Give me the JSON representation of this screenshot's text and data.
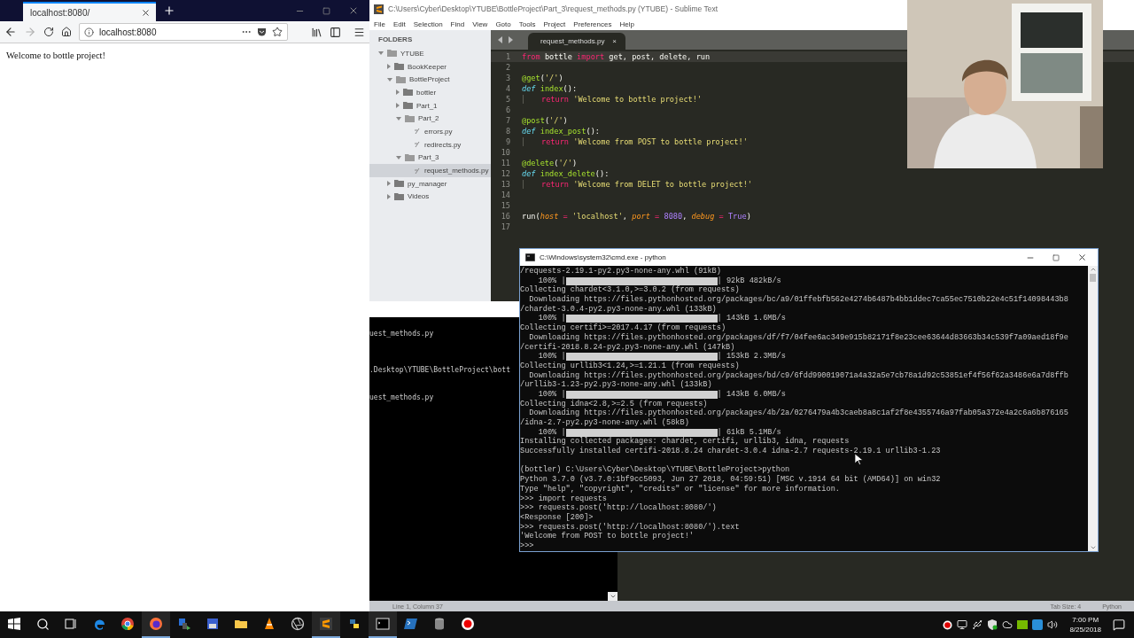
{
  "browser": {
    "tab": {
      "label": "localhost:8080/",
      "selected": true
    },
    "url": "localhost:8080",
    "can_go_forward": false,
    "content": "Welcome to bottle project!"
  },
  "editor": {
    "title": "C:\\Users\\Cyber\\Desktop\\YTUBE\\BottleProject\\Part_3\\request_methods.py (YTUBE) - Sublime Text",
    "menu": [
      "File",
      "Edit",
      "Selection",
      "Find",
      "View",
      "Goto",
      "Tools",
      "Project",
      "Preferences",
      "Help"
    ],
    "sidebar": {
      "heading": "FOLDERS",
      "items": [
        {
          "label": "YTUBE",
          "kind": "folder",
          "expanded": true,
          "selected": false,
          "children": [
            {
              "label": "BookKeeper",
              "kind": "folder",
              "expanded": false,
              "selected": false
            },
            {
              "label": "BottleProject",
              "kind": "folder",
              "expanded": true,
              "selected": false,
              "children": [
                {
                  "label": "bottler",
                  "kind": "folder",
                  "expanded": false,
                  "selected": false
                },
                {
                  "label": "Part_1",
                  "kind": "folder",
                  "expanded": false,
                  "selected": false
                },
                {
                  "label": "Part_2",
                  "kind": "folder",
                  "expanded": true,
                  "selected": false,
                  "children": [
                    {
                      "label": "errors.py",
                      "kind": "file",
                      "selected": false
                    },
                    {
                      "label": "redirects.py",
                      "kind": "file",
                      "selected": false
                    }
                  ]
                },
                {
                  "label": "Part_3",
                  "kind": "folder",
                  "expanded": true,
                  "selected": false,
                  "children": [
                    {
                      "label": "request_methods.py",
                      "kind": "file",
                      "selected": true
                    }
                  ]
                }
              ]
            },
            {
              "label": "py_manager",
              "kind": "folder",
              "expanded": false,
              "selected": false
            },
            {
              "label": "Videos",
              "kind": "folder",
              "expanded": false,
              "selected": false
            }
          ]
        }
      ]
    },
    "tab": {
      "label": "request_methods.py",
      "close": "×",
      "selected": true
    },
    "lines": [
      {
        "number": "1",
        "indented": false,
        "tokens": [
          {
            "kind": "keyword",
            "text": "from"
          },
          {
            "kind": "plain",
            "text": " bottle "
          },
          {
            "kind": "keyword",
            "text": "import"
          },
          {
            "kind": "plain",
            "text": " get, post, delete, run"
          }
        ]
      },
      {
        "number": "2"
      },
      {
        "number": "3",
        "indented": false,
        "tokens": [
          {
            "kind": "decorator",
            "text": "@get"
          },
          {
            "kind": "plain",
            "text": "("
          },
          {
            "kind": "string",
            "text": "'/'"
          },
          {
            "kind": "plain",
            "text": ")"
          }
        ]
      },
      {
        "number": "4",
        "indented": false,
        "tokens": [
          {
            "kind": "storage",
            "text": "def"
          },
          {
            "kind": "function",
            "text": " index"
          },
          {
            "kind": "plain",
            "text": "():"
          }
        ]
      },
      {
        "number": "5",
        "indented": true,
        "tokens": [
          {
            "kind": "keyword",
            "text": "return"
          },
          {
            "kind": "string",
            "text": " 'Welcome to bottle project!'"
          }
        ]
      },
      {
        "number": "6"
      },
      {
        "number": "7",
        "indented": false,
        "tokens": [
          {
            "kind": "decorator",
            "text": "@post"
          },
          {
            "kind": "plain",
            "text": "("
          },
          {
            "kind": "string",
            "text": "'/'"
          },
          {
            "kind": "plain",
            "text": ")"
          }
        ]
      },
      {
        "number": "8",
        "indented": false,
        "tokens": [
          {
            "kind": "storage",
            "text": "def"
          },
          {
            "kind": "function",
            "text": " index_post"
          },
          {
            "kind": "plain",
            "text": "():"
          }
        ]
      },
      {
        "number": "9",
        "indented": true,
        "tokens": [
          {
            "kind": "keyword",
            "text": "return"
          },
          {
            "kind": "string",
            "text": " 'Welcome from POST to bottle project!'"
          }
        ]
      },
      {
        "number": "10"
      },
      {
        "number": "11",
        "indented": false,
        "tokens": [
          {
            "kind": "decorator",
            "text": "@delete"
          },
          {
            "kind": "plain",
            "text": "("
          },
          {
            "kind": "string",
            "text": "'/'"
          },
          {
            "kind": "plain",
            "text": ")"
          }
        ]
      },
      {
        "number": "12",
        "indented": false,
        "tokens": [
          {
            "kind": "storage",
            "text": "def"
          },
          {
            "kind": "function",
            "text": " index_delete"
          },
          {
            "kind": "plain",
            "text": "():"
          }
        ]
      },
      {
        "number": "13",
        "indented": true,
        "tokens": [
          {
            "kind": "keyword",
            "text": "return"
          },
          {
            "kind": "string",
            "text": " 'Welcome from DELET to bottle project!'"
          }
        ]
      },
      {
        "number": "14"
      },
      {
        "number": "15"
      },
      {
        "number": "16",
        "indented": false,
        "tokens": [
          {
            "kind": "plain",
            "text": "run("
          },
          {
            "kind": "param",
            "text": "host"
          },
          {
            "kind": "keyword",
            "text": " = "
          },
          {
            "kind": "string",
            "text": "'localhost'"
          },
          {
            "kind": "plain",
            "text": ", "
          },
          {
            "kind": "param",
            "text": "port"
          },
          {
            "kind": "keyword",
            "text": " = "
          },
          {
            "kind": "number",
            "text": "8080"
          },
          {
            "kind": "plain",
            "text": ", "
          },
          {
            "kind": "param",
            "text": "debug"
          },
          {
            "kind": "keyword",
            "text": " = "
          },
          {
            "kind": "number",
            "text": "True"
          },
          {
            "kind": "plain",
            "text": ")"
          }
        ]
      },
      {
        "number": "17"
      }
    ],
    "status": {
      "position": "Line 1, Column 37",
      "tab_size": "Tab Size: 4",
      "syntax": "Python"
    }
  },
  "back_window": {
    "lines": [
      "uest_methods.py",
      ".Desktop\\YTUBE\\BottleProject\\bott",
      "uest_methods.py"
    ]
  },
  "terminal": {
    "title": "C:\\Windows\\system32\\cmd.exe - python",
    "lines": [
      {
        "kind": "text",
        "text": "/requests-2.19.1-py2.py3-none-any.whl (91kB)"
      },
      {
        "kind": "progress",
        "percent": "    100% |",
        "reading": "| 92kB 482kB/s"
      },
      {
        "kind": "text",
        "text": "Collecting chardet<3.1.0,>=3.0.2 (from requests)"
      },
      {
        "kind": "text",
        "text": "  Downloading https://files.pythonhosted.org/packages/bc/a9/01ffebfb562e4274b6487b4bb1ddec7ca55ec7510b22e4c51f14098443b8"
      },
      {
        "kind": "text",
        "text": "/chardet-3.0.4-py2.py3-none-any.whl (133kB)"
      },
      {
        "kind": "progress",
        "percent": "    100% |",
        "reading": "| 143kB 1.6MB/s"
      },
      {
        "kind": "text",
        "text": "Collecting certifi>=2017.4.17 (from requests)"
      },
      {
        "kind": "text",
        "text": "  Downloading https://files.pythonhosted.org/packages/df/f7/04fee6ac349e915b82171f8e23cee63644d83663b34c539f7a09aed18f9e"
      },
      {
        "kind": "text",
        "text": "/certifi-2018.8.24-py2.py3-none-any.whl (147kB)"
      },
      {
        "kind": "progress",
        "percent": "    100% |",
        "reading": "| 153kB 2.3MB/s"
      },
      {
        "kind": "text",
        "text": "Collecting urllib3<1.24,>=1.21.1 (from requests)"
      },
      {
        "kind": "text",
        "text": "  Downloading https://files.pythonhosted.org/packages/bd/c9/6fdd990019071a4a32a5e7cb78a1d92c53851ef4f56f62a3486e6a7d8ffb"
      },
      {
        "kind": "text",
        "text": "/urllib3-1.23-py2.py3-none-any.whl (133kB)"
      },
      {
        "kind": "progress",
        "percent": "    100% |",
        "reading": "| 143kB 6.0MB/s"
      },
      {
        "kind": "text",
        "text": "Collecting idna<2.8,>=2.5 (from requests)"
      },
      {
        "kind": "text",
        "text": "  Downloading https://files.pythonhosted.org/packages/4b/2a/0276479a4b3caeb8a8c1af2f8e4355746a97fab05a372e4a2c6a6b876165"
      },
      {
        "kind": "text",
        "text": "/idna-2.7-py2.py3-none-any.whl (58kB)"
      },
      {
        "kind": "progress",
        "percent": "    100% |",
        "reading": "| 61kB 5.1MB/s"
      },
      {
        "kind": "text",
        "text": "Installing collected packages: chardet, certifi, urllib3, idna, requests"
      },
      {
        "kind": "text",
        "text": "Successfully installed certifi-2018.8.24 chardet-3.0.4 idna-2.7 requests-2.19.1 urllib3-1.23"
      },
      {
        "kind": "blank"
      },
      {
        "kind": "text",
        "text": "(bottler) C:\\Users\\Cyber\\Desktop\\YTUBE\\BottleProject>python"
      },
      {
        "kind": "text",
        "text": "Python 3.7.0 (v3.7.0:1bf9cc5093, Jun 27 2018, 04:59:51) [MSC v.1914 64 bit (AMD64)] on win32"
      },
      {
        "kind": "text",
        "text": "Type \"help\", \"copyright\", \"credits\" or \"license\" for more information."
      },
      {
        "kind": "text",
        "text": ">>> import requests"
      },
      {
        "kind": "text",
        "text": ">>> requests.post('http://localhost:8080/')"
      },
      {
        "kind": "text",
        "text": "<Response [200]>"
      },
      {
        "kind": "text",
        "text": ">>> requests.post('http://localhost:8080/').text"
      },
      {
        "kind": "text",
        "text": "'Welcome from POST to bottle project!'"
      },
      {
        "kind": "text",
        "text": ">>>"
      }
    ]
  },
  "taskbar": {
    "items": [
      {
        "kind": "start",
        "running": false
      },
      {
        "kind": "search",
        "running": false
      },
      {
        "kind": "taskview",
        "running": false
      },
      {
        "kind": "edge",
        "running": false
      },
      {
        "kind": "chrome",
        "running": false
      },
      {
        "kind": "firefox",
        "running": true
      },
      {
        "kind": "network",
        "running": false
      },
      {
        "kind": "disk",
        "running": false
      },
      {
        "kind": "folder",
        "running": false
      },
      {
        "kind": "cone",
        "running": false
      },
      {
        "kind": "aperture",
        "running": false
      },
      {
        "kind": "sublime",
        "running": true
      },
      {
        "kind": "python",
        "running": false
      },
      {
        "kind": "terminal",
        "running": true
      },
      {
        "kind": "shell",
        "running": false
      },
      {
        "kind": "database",
        "running": false
      },
      {
        "kind": "record",
        "running": false
      }
    ],
    "time": "7:00 PM",
    "date": "8/25/2018"
  }
}
